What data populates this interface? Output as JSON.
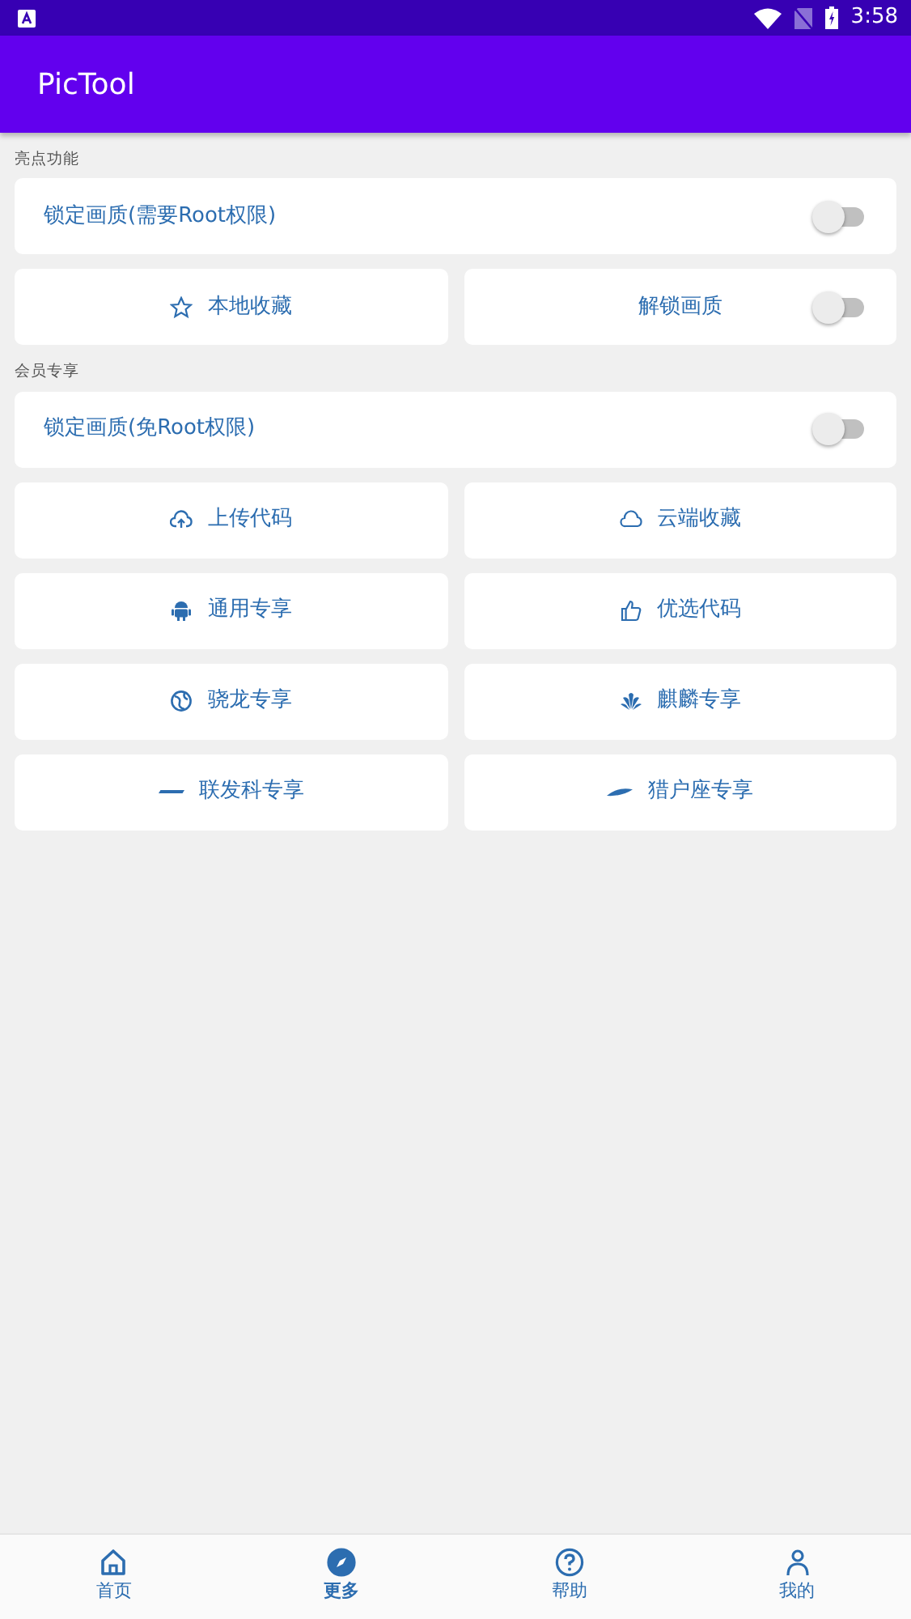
{
  "status_bar": {
    "time": "3:58"
  },
  "app_bar": {
    "title": "PicTool"
  },
  "sections": [
    {
      "title": "亮点功能",
      "rows": [
        [
          {
            "kind": "toggle",
            "label": "锁定画质(需要Root权限)",
            "on": false
          }
        ],
        [
          {
            "kind": "button",
            "label": "本地收藏"
          },
          {
            "kind": "toggle",
            "label": "解锁画质",
            "on": false
          }
        ]
      ]
    },
    {
      "title": "会员专享",
      "rows": [
        [
          {
            "kind": "toggle",
            "label": "锁定画质(免Root权限)",
            "on": false
          }
        ],
        [
          {
            "kind": "button",
            "label": "上传代码"
          },
          {
            "kind": "button",
            "label": "云端收藏"
          }
        ],
        [
          {
            "kind": "button",
            "label": "通用专享"
          },
          {
            "kind": "button",
            "label": "优选代码"
          }
        ],
        [
          {
            "kind": "button",
            "label": "骁龙专享"
          },
          {
            "kind": "button",
            "label": "麒麟专享"
          }
        ],
        [
          {
            "kind": "button",
            "label": "联发科专享"
          },
          {
            "kind": "button",
            "label": "猎户座专享"
          }
        ]
      ]
    }
  ],
  "bottom_nav": [
    {
      "label": "首页",
      "selected": false
    },
    {
      "label": "更多",
      "selected": true
    },
    {
      "label": "帮助",
      "selected": false
    },
    {
      "label": "我的",
      "selected": false
    }
  ]
}
